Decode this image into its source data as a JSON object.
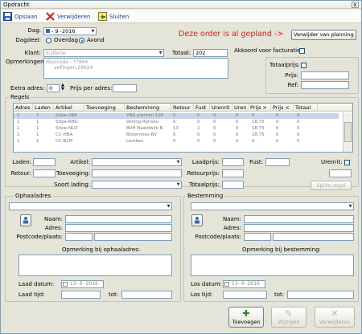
{
  "window": {
    "title": "Opdracht",
    "close_glyph": "x"
  },
  "toolbar": {
    "save_label": "Opslaan",
    "save_icon": "save-icon",
    "delete_label": "Verwijderen",
    "delete_icon": "delete-icon",
    "close_label": "Sluiten",
    "close_icon": "exit-icon"
  },
  "form": {
    "dag_label": "Dag:",
    "dag_value": "- 9 -2016",
    "dagdeel_label": "Dagdeel:",
    "overdag_label": "Overdag",
    "avond_label": "Avond",
    "dagdeel_selected": "Avond",
    "warning": "Deze order is al gepland ->",
    "remove_planning_label": "Verwijder van planning",
    "klant_label": "Klant:",
    "klant_value": "Euflorie",
    "totaal_label": "Totaal:",
    "totaal_value": "202",
    "akkoord_label": "Akkoord voor facturatie:",
    "opmerkingen_label": "Opmerkingen:",
    "opmerkingen_value": "deurcode - *7864",
    "opmerkingen_value2": "vellingen,29024",
    "totaalprijs_label": "Totaalprijs:",
    "prijs_label": "Prijs:",
    "ref_label": "Ref:",
    "extra_adres_label": "Extra adres:",
    "extra_adres_value": "0",
    "prijs_per_adres_label": "Prijs per adres:"
  },
  "regels": {
    "title": "Regels",
    "columns": [
      "Adres",
      "Laden",
      "Artikel",
      "Toevoeging",
      "Bestemming",
      "Retour",
      "Fust",
      "Urenrit",
      "Uren",
      "Prijs >",
      "Prijs <",
      "Totaal"
    ],
    "rows": [
      [
        "1",
        "1",
        "Stipe-VBA",
        "",
        "VBA planten 100",
        "0",
        "0",
        "0",
        "0",
        "0",
        "0",
        "0"
      ],
      [
        "1",
        "1",
        "Stipe-RBG",
        "",
        "Veiling Rijnsbu",
        "0",
        "0",
        "0",
        "0",
        "18,75",
        "0",
        "0"
      ],
      [
        "1",
        "1",
        "Stipe-NLD",
        "",
        "BVH Naaldwijk B",
        "13",
        "2",
        "0",
        "0",
        "18,75",
        "0",
        "0"
      ],
      [
        "1",
        "1",
        "CC-HBA",
        "",
        "Bloominex BV",
        "0",
        "0",
        "0",
        "0",
        "18,75",
        "0",
        "0"
      ],
      [
        "1",
        "1",
        "CC-BLM",
        "",
        "Lemkes",
        "0",
        "0",
        "0",
        "0",
        "0",
        "0",
        "0"
      ]
    ],
    "laden_label": "Laden:",
    "artikel_label": "Artikel:",
    "laadprijs_label": "Laadprijs:",
    "fust_label": "Fust:",
    "urenrit_label": "Urenrit:",
    "retour_label": "Retour:",
    "toevoeging_label": "Toevoeging:",
    "retourprijs_label": "Retourprijs:",
    "soort_lading_label": "Soort lading:",
    "totaalprijs_label": "Totaalprijs:",
    "split_label": "Splits regel"
  },
  "ophaaladres": {
    "title": "Ophaaladres",
    "naam_label": "Naam:",
    "adres_label": "Adres:",
    "postcode_label": "Postcode/plaats:",
    "opmerking_label": "Opmerking bij ophaaladres:",
    "laad_datum_label": "Laad datum:",
    "laad_datum_value": "13- 9 -2016",
    "laad_tijd_label": "Laad tijd:",
    "tot_label": "tot:"
  },
  "bestemming": {
    "title": "Bestemming",
    "naam_label": "Naam:",
    "adres_label": "Adres:",
    "postcode_label": "Postcode/plaats:",
    "opmerking_label": "Opmerking bij bestemming:",
    "los_datum_label": "Los datum:",
    "los_datum_value": "13- 9 -2016",
    "los_tijd_label": "Los tijd:",
    "tot_label": "tot:"
  },
  "actions": {
    "add_label": "Toevoegen",
    "edit_label": "Wijzigen",
    "remove_label": "Verwijderen",
    "add_icon": "plus-icon",
    "edit_icon": "pencil-icon",
    "remove_icon": "cross-icon"
  },
  "colors": {
    "warning": "#e01b1b",
    "toolbar_text": "#1f3f9f",
    "window_bg": "#e4e4d9"
  }
}
